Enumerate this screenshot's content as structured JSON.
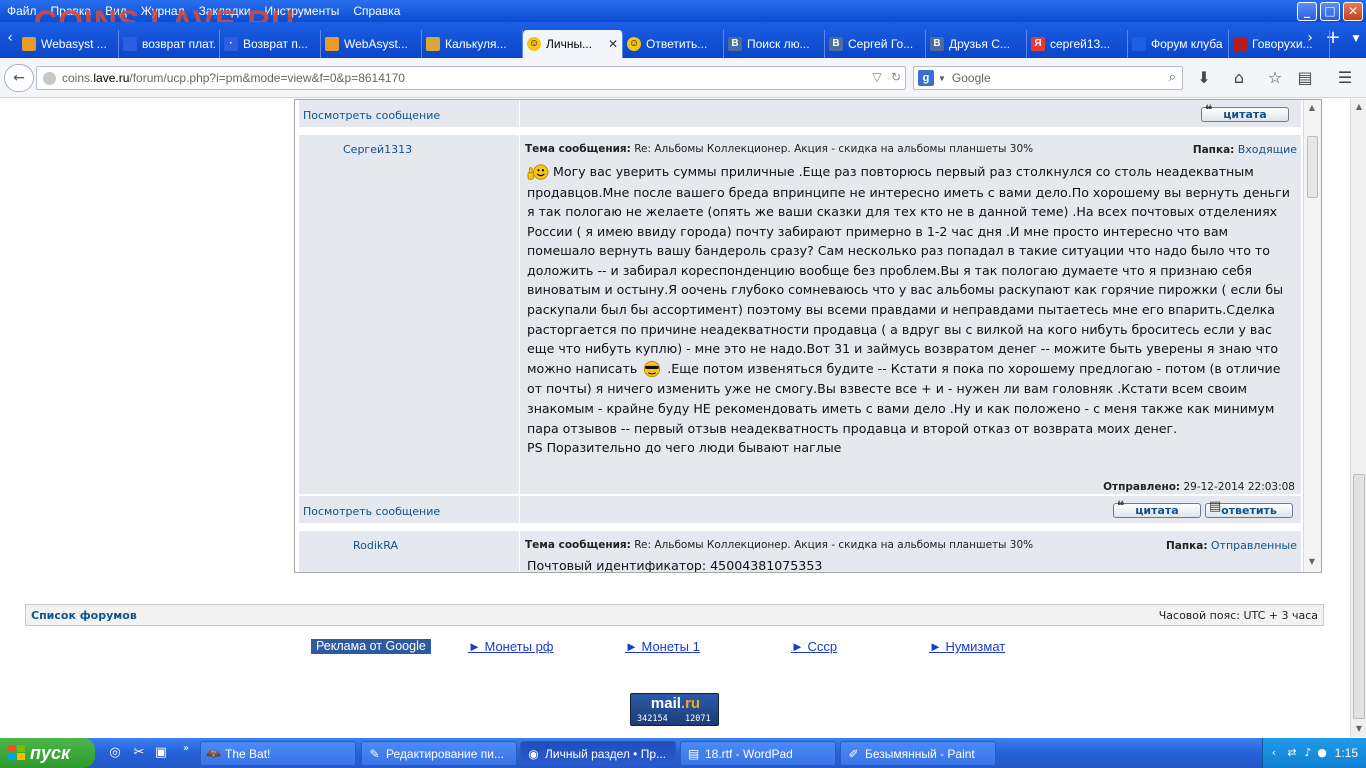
{
  "watermark": "COINS.LAVE.RU",
  "menu": [
    "Файл",
    "Правка",
    "Вид",
    "Журнал",
    "Закладки",
    "Инструменты",
    "Справка"
  ],
  "window_buttons": {
    "minimize": "_",
    "maximize": "□",
    "close": "✕"
  },
  "tabs": [
    {
      "label": "Webasyst ...",
      "icon_color": "#e59c2a",
      "icon_text": ""
    },
    {
      "label": "возврат плат...",
      "icon_color": "#2c5ee0",
      "icon_text": ""
    },
    {
      "label": "Возврат п...",
      "icon_color": "#2c5ee0",
      "icon_text": "·"
    },
    {
      "label": "WebAsyst...",
      "icon_color": "#e59c2a",
      "icon_text": ""
    },
    {
      "label": "Калькуля...",
      "icon_color": "#d9a63a",
      "icon_text": ""
    },
    {
      "label": "Личны...",
      "icon_color": "#f5c518",
      "icon_text": "☺",
      "active": true
    },
    {
      "label": "Ответить...",
      "icon_color": "#f5c518",
      "icon_text": "☺"
    },
    {
      "label": "Поиск лю...",
      "icon_color": "#4a6d9e",
      "icon_text": "B"
    },
    {
      "label": "Сергей Го...",
      "icon_color": "#4a6d9e",
      "icon_text": "B"
    },
    {
      "label": "Друзья С...",
      "icon_color": "#4a6d9e",
      "icon_text": "B"
    },
    {
      "label": "сергей13...",
      "icon_color": "#e53935",
      "icon_text": "Я"
    },
    {
      "label": "Форум клуба ...",
      "icon_color": "#1b5fe5",
      "icon_text": ""
    },
    {
      "label": "Говорухи...",
      "icon_color": "#b71c1c",
      "icon_text": ""
    }
  ],
  "tab_close": "✕",
  "url": {
    "prefix": "coins.",
    "host": "lave.ru",
    "path": "/forum/ucp.php?i=pm&mode=view&f=0&p=8614170"
  },
  "search": {
    "engine_icon": "g",
    "placeholder": "Google"
  },
  "pm": {
    "view_message_label": "Посмотреть сообщение",
    "quote_label": "цитата",
    "reply_label": "ответить",
    "subject_label": "Тема сообщения:",
    "folder_label": "Папка:",
    "sent_label": "Отправлено:",
    "messages": [
      {
        "author": "Сергей1313",
        "subject": "Re: Альбомы Коллекционер. Акция - скидка на альбомы планшеты 30%",
        "folder": "Входящие",
        "body_part1": " Могу вас уверить суммы приличные .Еще раз повторюсь первый раз столкнулся со столь неадекватным продавцов.Мне после вашего бреда впринципе не интересно иметь с вами дело.По хорошему вы вернуть деньги я так пологаю не желаете (опять же ваши сказки для тех кто не в данной теме) .На всех почтовых отделениях России ( я имею ввиду города) почту забирают примерно в 1-2 час дня .И мне просто интересно что вам помешало вернуть вашу бандероль сразу? Сам несколько раз попадал в такие ситуации что надо было что то доложить -- и забирал кореспонденцию вообще без проблем.Вы я так пологаю думаете что я признаю себя виноватым и остыну.Я оочень глубоко сомневаюсь что у вас альбомы раскупают как горячие пирожки ( если бы раскупали был бы ассортимент) поэтому вы всеми правдами и неправдами пытаетесь мне его впарить.Сделка расторгается по причине неадекватности продавца ( а вдруг вы с вилкой на кого нибуть броситесь если у вас еще что нибуть куплю) - мне это не надо.Вот 31 и займусь возвратом денег -- можите быть уверены я знаю что можно написать ",
        "body_part2": " .Еще потом извеняться будите -- Кстати я пока по хорошему предлогаю - потом (в отличие от почты) я ничего изменить уже не смогу.Вы взвесте все + и - нужен ли вам головняк .Кстати всем своим знакомым - крайне буду НЕ рекомендовать иметь с вами дело .Ну и как положено - с меня также как минимум пара отзывов -- первый отзыв неадекватность продавца и второй отказ от возврата моих денег.",
        "ps": "PS Поразительно до чего люди бывают наглые",
        "sent": "29-12-2014 22:03:08"
      },
      {
        "author": "RodikRA",
        "subject": "Re: Альбомы Коллекционер. Акция - скидка на альбомы планшеты 30%",
        "folder": "Отправленные",
        "body_preview": "Почтовый идентификатор: 45004381075353"
      }
    ]
  },
  "forum_bar": {
    "forum_list": "Список форумов",
    "timezone": "Часовой пояс: UTC + 3 часа"
  },
  "ads": {
    "google": "Реклама от Google",
    "links": [
      "► Монеты рф",
      "► Монеты 1",
      "► Ссср",
      "► Нумизмат"
    ]
  },
  "mailru": {
    "logo_main": "mail",
    "logo_dot": ".ru",
    "count1": "342154",
    "count2": "12071"
  },
  "taskbar": {
    "start": "пуск",
    "tasks": [
      {
        "label": "The Bat!",
        "icon": "🦇"
      },
      {
        "label": "Редактирование пи...",
        "icon": "✎"
      },
      {
        "label": "Личный раздел • Пр...",
        "icon": "◉",
        "active": true
      },
      {
        "label": "18.rtf - WordPad",
        "icon": "▤"
      },
      {
        "label": "Безымянный - Paint",
        "icon": "✐"
      }
    ],
    "clock": "1:15"
  }
}
